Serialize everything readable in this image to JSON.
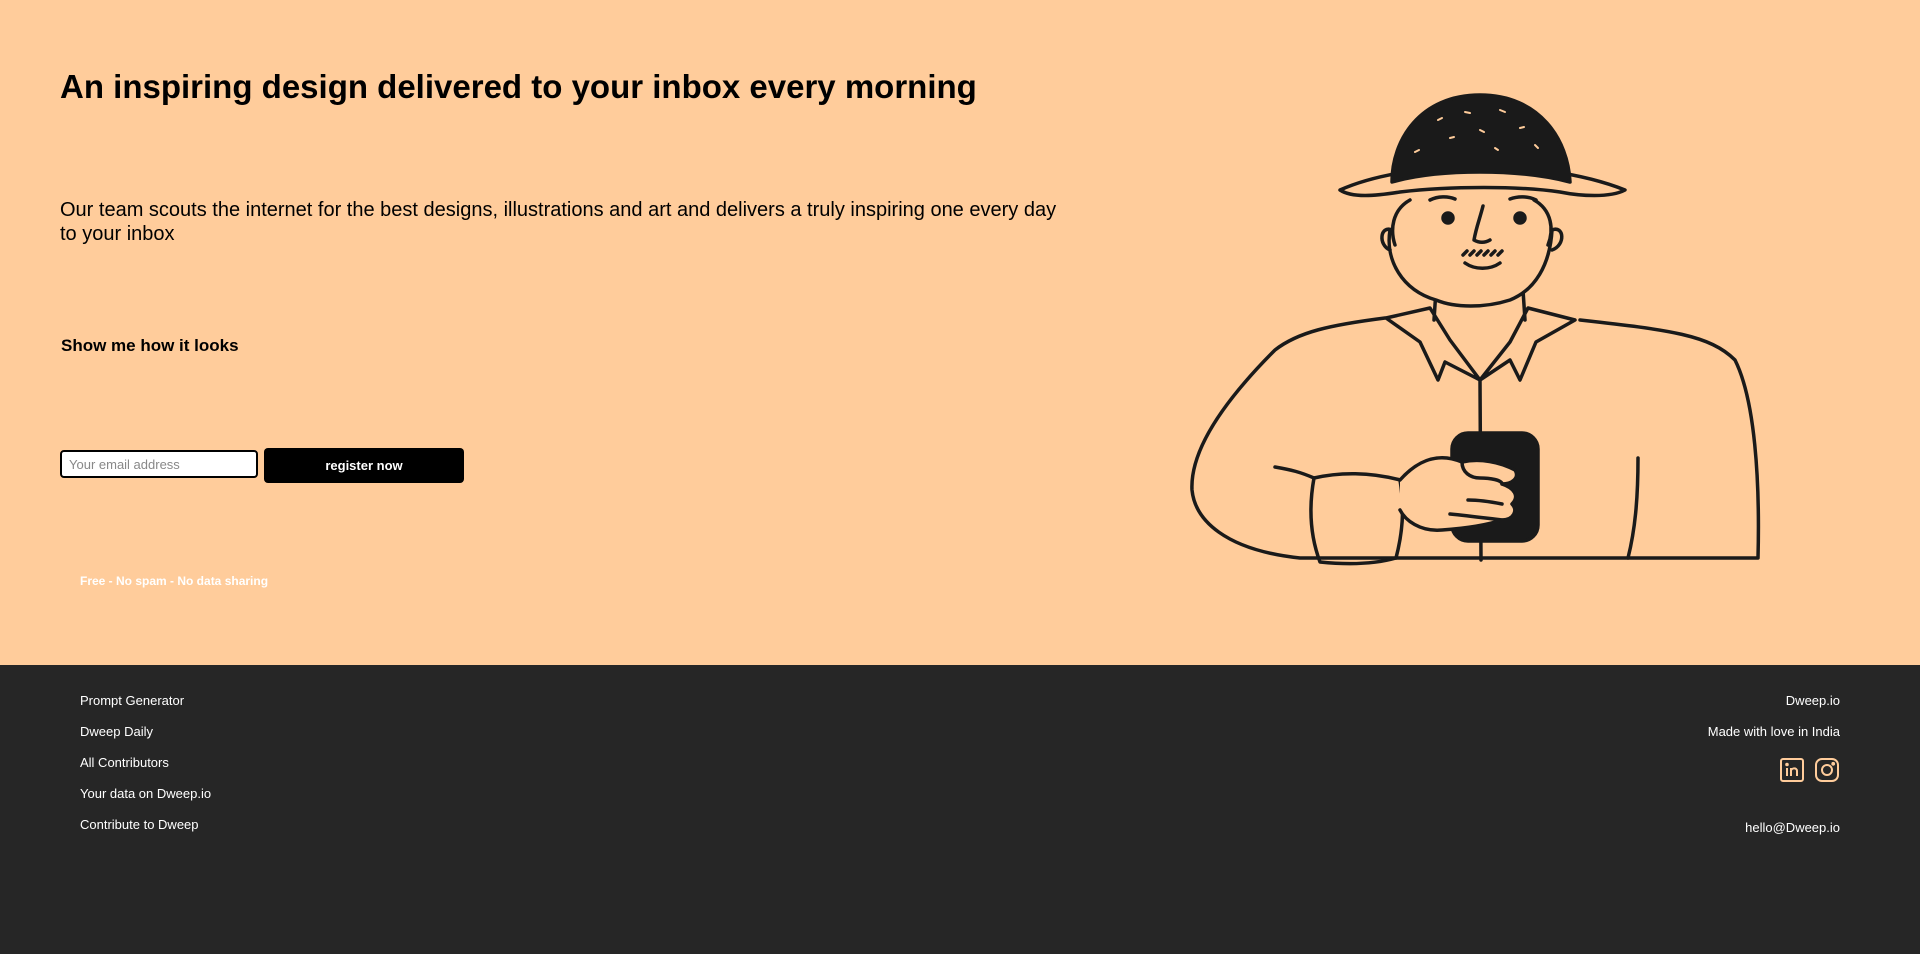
{
  "hero": {
    "headline": "An inspiring design delivered to your inbox every morning",
    "subtext": "Our team scouts the internet for the best designs, illustrations and art and delivers a truly inspiring one every day to your inbox",
    "show_link": "Show me how it looks",
    "email_placeholder": "Your email address",
    "register_label": "register now",
    "tagline": "Free - No spam - No data sharing"
  },
  "footer": {
    "links": [
      "Prompt Generator",
      "Dweep Daily",
      "All Contributors",
      "Your data on Dweep.io",
      "Contribute to Dweep"
    ],
    "brand": "Dweep.io",
    "made_with": "Made with love in India",
    "email": "hello@Dweep.io",
    "social_icons": [
      "linkedin-icon",
      "instagram-icon"
    ]
  },
  "colors": {
    "hero_background": "#ffcc9b",
    "footer_background": "#262626",
    "accent": "#000000",
    "icon_color": "#ffcc9b"
  }
}
